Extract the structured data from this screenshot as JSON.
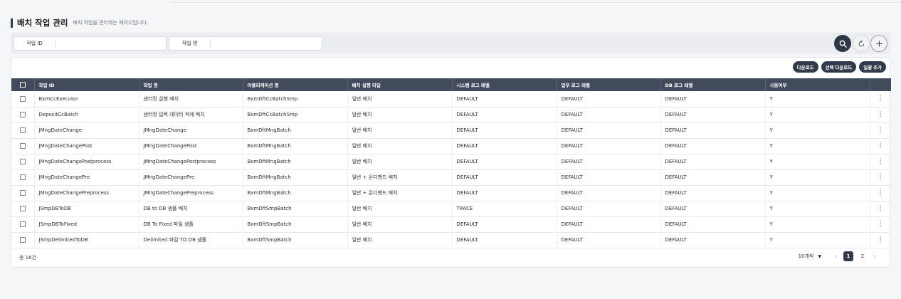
{
  "page": {
    "title": "배치 작업 관리",
    "subtitle": "배치 작업을 관리하는 페이지입니다."
  },
  "search": {
    "job_id_label": "작업 ID",
    "job_id_value": "",
    "job_name_label": "작업 명",
    "job_name_value": "",
    "search_icon": "search-icon",
    "reset_icon": "refresh-icon",
    "add_icon": "plus-icon"
  },
  "toolbar": {
    "download": "다운로드",
    "selected_download": "선택 다운로드",
    "bulk_add": "일괄 추가"
  },
  "table": {
    "columns": [
      "작업 ID",
      "작업 명",
      "어플리케이션 명",
      "배치 실행 타입",
      "시스템 로그 레벨",
      "업무 로그 레벨",
      "DB 로그 레벨",
      "사용여부"
    ],
    "rows": [
      {
        "id": "BxmCcExecutor",
        "name": "센터컷 실행 배치",
        "app": "BxmDftCcBatchSmp",
        "type": "일반 배치",
        "sys": "DEFAULT",
        "biz": "DEFAULT",
        "db": "DEFAULT",
        "use": "Y"
      },
      {
        "id": "DepositCcBatch",
        "name": "센터컷 입력 데이터 적재 배치",
        "app": "BxmDftCcBatchSmp",
        "type": "일반 배치",
        "sys": "DEFAULT",
        "biz": "DEFAULT",
        "db": "DEFAULT",
        "use": "Y"
      },
      {
        "id": "JMngDateChange",
        "name": "JMngDateChange",
        "app": "BxmDftMngBatch",
        "type": "일반 배치",
        "sys": "DEFAULT",
        "biz": "DEFAULT",
        "db": "DEFAULT",
        "use": "Y"
      },
      {
        "id": "JMngDateChangePost",
        "name": "JMngDateChangePost",
        "app": "BxmDftMngBatch",
        "type": "일반 배치",
        "sys": "DEFAULT",
        "biz": "DEFAULT",
        "db": "DEFAULT",
        "use": "Y"
      },
      {
        "id": "JMngDateChangePostprocess",
        "name": "JMngDateChangePostprocess",
        "app": "BxmDftMngBatch",
        "type": "일반 배치",
        "sys": "DEFAULT",
        "biz": "DEFAULT",
        "db": "DEFAULT",
        "use": "Y"
      },
      {
        "id": "JMngDateChangePre",
        "name": "JMngDateChangePre",
        "app": "BxmDftMngBatch",
        "type": "일반 + 온디맨드 배치",
        "sys": "DEFAULT",
        "biz": "DEFAULT",
        "db": "DEFAULT",
        "use": "Y"
      },
      {
        "id": "JMngDateChangePreprocess",
        "name": "JMngDateChangePreprocess",
        "app": "BxmDftMngBatch",
        "type": "일반 + 온디맨드 배치",
        "sys": "DEFAULT",
        "biz": "DEFAULT",
        "db": "DEFAULT",
        "use": "Y"
      },
      {
        "id": "JSmpDBToDB",
        "name": "DB to DB 샘플 배치",
        "app": "BxmDftSmpBatch",
        "type": "일반 배치",
        "sys": "TRACE",
        "biz": "DEFAULT",
        "db": "DEFAULT",
        "use": "Y"
      },
      {
        "id": "JSmpDBToFixed",
        "name": "DB To Fixed 파일 샘플",
        "app": "BxmDftSmpBatch",
        "type": "일반 배치",
        "sys": "DEFAULT",
        "biz": "DEFAULT",
        "db": "DEFAULT",
        "use": "Y"
      },
      {
        "id": "JSmpDelimitedToDB",
        "name": "Delimited 파일 TO DB 샘플",
        "app": "BxmDftSmpBatch",
        "type": "일반 배치",
        "sys": "DEFAULT",
        "biz": "DEFAULT",
        "db": "DEFAULT",
        "use": "Y"
      }
    ],
    "row_menu_glyph": "⋮"
  },
  "footer": {
    "total": "총 16건",
    "page_size": "10개씩",
    "prev": "‹",
    "next": "›",
    "pages": [
      "1",
      "2"
    ],
    "current_page": "1"
  }
}
